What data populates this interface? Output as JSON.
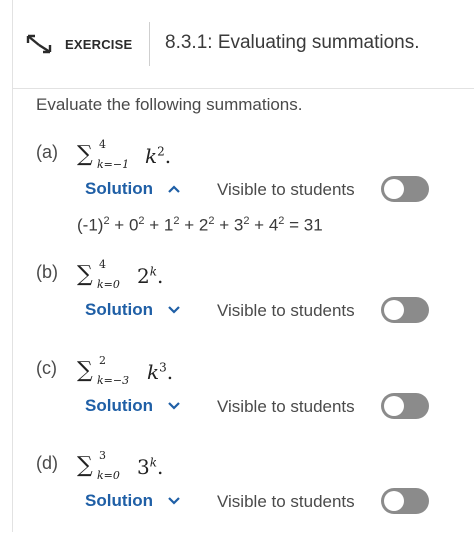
{
  "header": {
    "icon": "expand-arrows-icon",
    "exercise_label": "EXERCISE",
    "title": "8.3.1: Evaluating summations."
  },
  "intro": "Evaluate the following summations.",
  "parts": [
    {
      "label": "(a)",
      "upper": "4",
      "lower": "k=−1",
      "base": "k",
      "exponent": "2",
      "solution_label": "Solution",
      "expanded": true,
      "visibility_label": "Visible to students",
      "visible": false
    },
    {
      "label": "(b)",
      "upper": "4",
      "lower": "k=0",
      "base": "2",
      "exponent": "k",
      "solution_label": "Solution",
      "expanded": false,
      "visibility_label": "Visible to students",
      "visible": false
    },
    {
      "label": "(c)",
      "upper": "2",
      "lower": "k=−3",
      "base": "k",
      "exponent": "3",
      "solution_label": "Solution",
      "expanded": false,
      "visibility_label": "Visible to students",
      "visible": false
    },
    {
      "label": "(d)",
      "upper": "3",
      "lower": "k=0",
      "base": "3",
      "exponent": "k",
      "solution_label": "Solution",
      "expanded": false,
      "visibility_label": "Visible to students",
      "visible": false
    }
  ],
  "answer_a": {
    "terms": [
      {
        "base": "(-1)",
        "exp": "2"
      },
      {
        "base": "0",
        "exp": "2"
      },
      {
        "base": "1",
        "exp": "2"
      },
      {
        "base": "2",
        "exp": "2"
      },
      {
        "base": "3",
        "exp": "2"
      },
      {
        "base": "4",
        "exp": "2"
      }
    ],
    "result": "31"
  },
  "colors": {
    "solution": "#1f5fa6",
    "toggle_off": "#8b8b8b"
  }
}
